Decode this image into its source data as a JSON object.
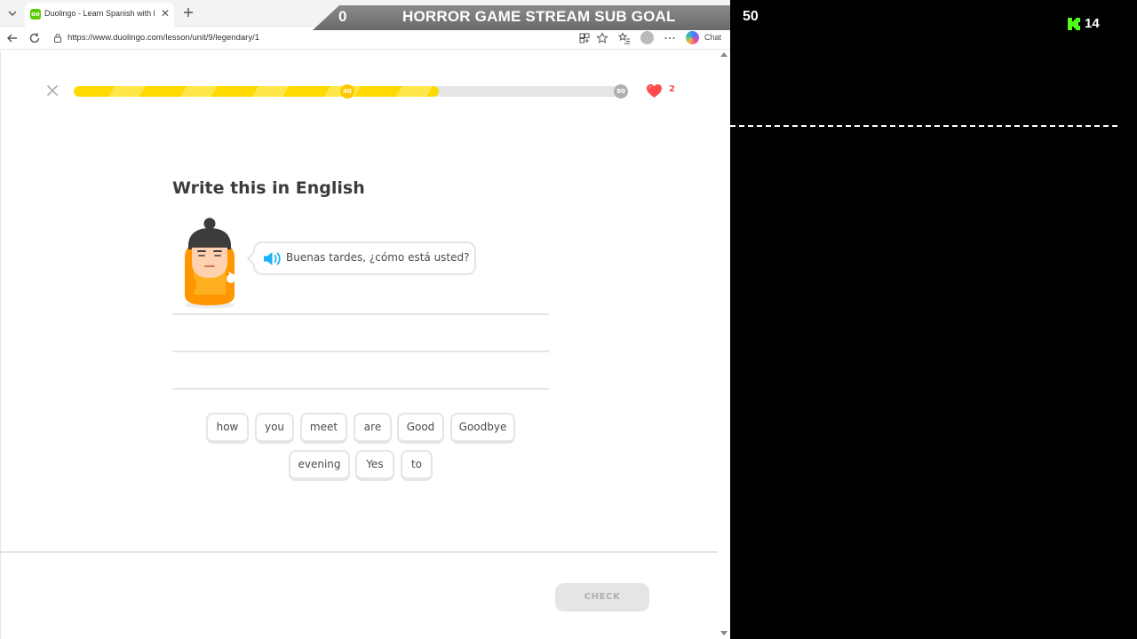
{
  "browser": {
    "tab": {
      "title": "Duolingo - Learn Spanish with lessons",
      "favicon_text": "oo",
      "close_glyph": "✕"
    },
    "address_bar": {
      "url": "https://www.duolingo.com/lesson/unit/9/legendary/1"
    },
    "copilot_label": "Chat"
  },
  "lesson": {
    "progress": {
      "fraction": 0.66,
      "milestone_mid": "40",
      "milestone_end": "80"
    },
    "hearts": "2",
    "title": "Write this in English",
    "prompt": "Buenas tardes, ¿cómo está usted?",
    "word_bank": [
      [
        "how",
        "you",
        "meet",
        "are",
        "Good",
        "Goodbye"
      ],
      [
        "evening",
        "Yes",
        "to"
      ]
    ],
    "check_label": "CHECK"
  },
  "stream": {
    "sub_goal_current": "0",
    "sub_goal_title": "HORROR GAME STREAM SUB GOAL",
    "sub_goal_target": "50",
    "viewer_count": "14"
  },
  "colors": {
    "duolingo_green": "#58cc02",
    "progress_yellow": "#ffd900",
    "heart_red": "#ff4b4b",
    "speaker_blue": "#1cb0f6",
    "kick_green": "#53fc18"
  }
}
